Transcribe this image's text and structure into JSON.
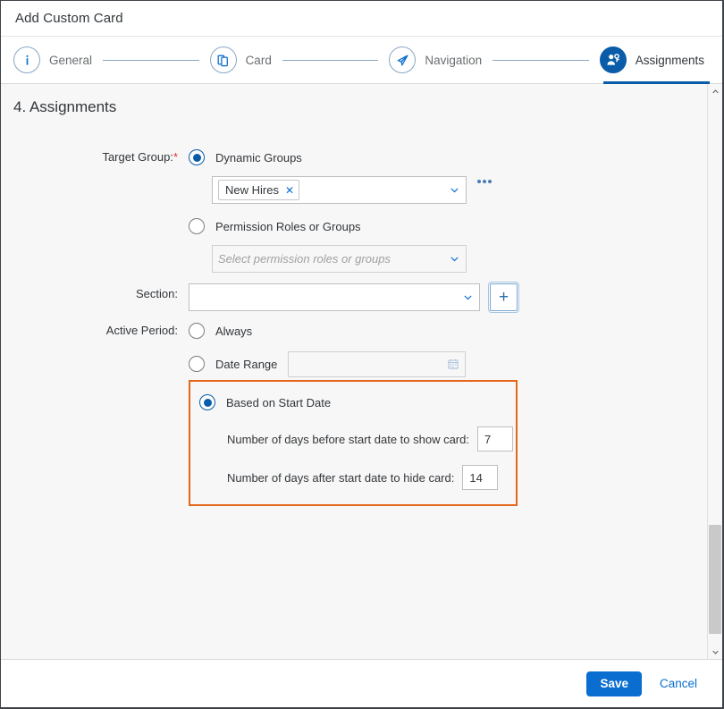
{
  "dialog": {
    "title": "Add Custom Card"
  },
  "wizard": {
    "steps": [
      {
        "label": "General",
        "icon": "info-icon",
        "active": false
      },
      {
        "label": "Card",
        "icon": "copy-icon",
        "active": false
      },
      {
        "label": "Navigation",
        "icon": "paper-plane-icon",
        "active": false
      },
      {
        "label": "Assignments",
        "icon": "user-key-icon",
        "active": true
      }
    ]
  },
  "main": {
    "section_title": "4. Assignments",
    "target_group": {
      "label": "Target Group:",
      "required_mark": "*",
      "option_dynamic": "Dynamic Groups",
      "option_permission": "Permission Roles or Groups",
      "dynamic_token": "New Hires",
      "token_remove": "✕",
      "permission_placeholder": "Select permission roles or groups",
      "ellipsis_label": "•••"
    },
    "section": {
      "label": "Section:",
      "value": "",
      "add_label": "+"
    },
    "active_period": {
      "label": "Active Period:",
      "option_always": "Always",
      "option_date_range": "Date Range",
      "date_range_value": "",
      "option_start_date": "Based on Start Date",
      "days_before_label": "Number of days before start date to show card:",
      "days_before_value": "7",
      "days_after_label": "Number of days after start date to hide card:",
      "days_after_value": "14"
    }
  },
  "footer": {
    "save_label": "Save",
    "cancel_label": "Cancel"
  },
  "colors": {
    "accent_blue": "#0a6ed1",
    "step_active_blue": "#0a5ca8",
    "highlight_orange": "#e4671b",
    "required_red": "#e03131"
  }
}
